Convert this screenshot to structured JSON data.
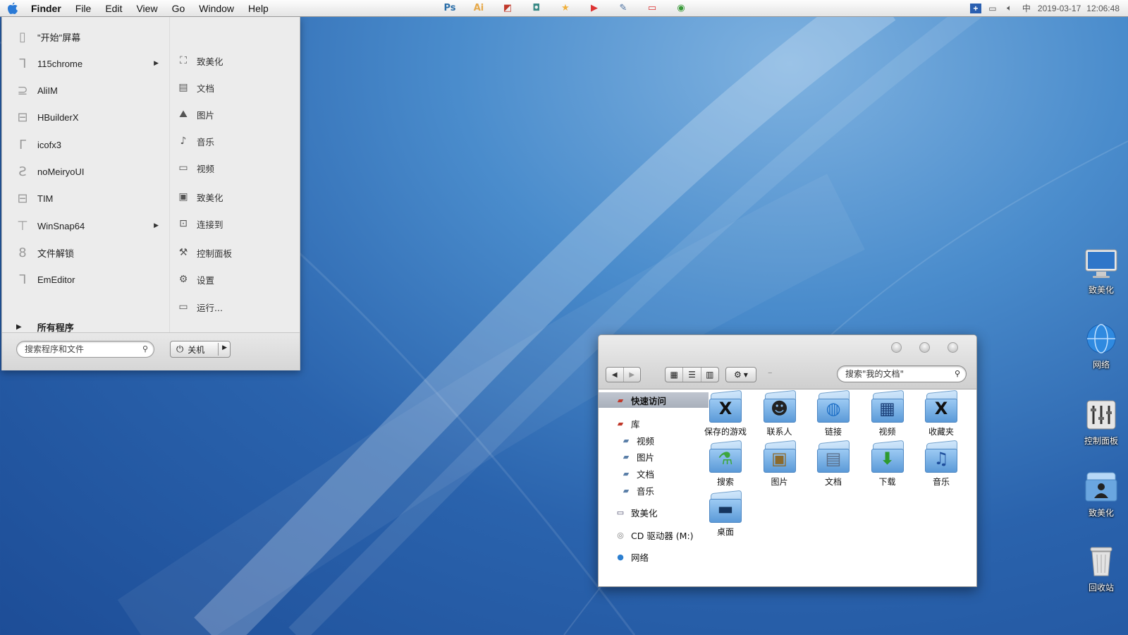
{
  "menubar": {
    "app_name": "Finder",
    "menus": [
      "File",
      "Edit",
      "View",
      "Go",
      "Window",
      "Help"
    ],
    "tray_left": [
      {
        "icon": "photoshop-icon",
        "label": "Ps",
        "color": "#2b6ea8"
      },
      {
        "icon": "illustrator-icon",
        "label": "Ai",
        "color": "#e6a94a"
      },
      {
        "icon": "screenshot-icon",
        "label": "◩",
        "color": "#c0392b"
      },
      {
        "icon": "camera-icon",
        "label": "◘",
        "color": "#3a8a86"
      },
      {
        "icon": "star-icon",
        "label": "★",
        "color": "#f0b03c"
      },
      {
        "icon": "youtube-icon",
        "label": "▶",
        "color": "#d33"
      },
      {
        "icon": "note-icon",
        "label": "✎",
        "color": "#4a6fa0"
      },
      {
        "icon": "remote-desktop-icon",
        "label": "▭",
        "color": "#d33"
      },
      {
        "icon": "chrome-icon",
        "label": "◉",
        "color": "#3a9a3a"
      }
    ],
    "tray_right": {
      "date": "2019-03-17",
      "time": "12:06:48"
    }
  },
  "start_menu": {
    "programs": [
      {
        "label": "\"开始\"屏幕",
        "icon": "start-screen-icon",
        "glyph": "▯",
        "submenu": false
      },
      {
        "label": "115chrome",
        "icon": "app-icon-115chrome",
        "glyph": "ᒣ",
        "submenu": true
      },
      {
        "label": "AliIM",
        "icon": "app-icon-aliim",
        "glyph": "⊇",
        "submenu": false
      },
      {
        "label": "HBuilderX",
        "icon": "app-icon-hbuilderx",
        "glyph": "⊟",
        "submenu": false
      },
      {
        "label": "icofx3",
        "icon": "app-icon-icofx3",
        "glyph": "ᒥ",
        "submenu": false
      },
      {
        "label": "noMeiryoUI",
        "icon": "app-icon-nomeiryoui",
        "glyph": "Ƨ",
        "submenu": false
      },
      {
        "label": "TIM",
        "icon": "app-icon-tim",
        "glyph": "⊟",
        "submenu": false
      },
      {
        "label": "WinSnap64",
        "icon": "app-icon-winsnap64",
        "glyph": "⊤",
        "submenu": true
      },
      {
        "label": "文件解锁",
        "icon": "app-icon-unlocker",
        "glyph": "8",
        "submenu": false
      },
      {
        "label": "EmEditor",
        "icon": "app-icon-emeditor",
        "glyph": "ᒣ",
        "submenu": false
      }
    ],
    "all_programs": "所有程序",
    "places": [
      {
        "label": "致美化",
        "icon": "user-icon",
        "glyph": "⛶"
      },
      {
        "label": "文档",
        "icon": "document-icon",
        "glyph": "▤"
      },
      {
        "label": "图片",
        "icon": "picture-icon",
        "glyph": "⛰"
      },
      {
        "label": "音乐",
        "icon": "music-icon",
        "glyph": "♪"
      },
      {
        "label": "视频",
        "icon": "video-icon",
        "glyph": "▭"
      },
      {
        "label": "致美化",
        "icon": "computer-icon",
        "glyph": "▣"
      },
      {
        "label": "连接到",
        "icon": "connect-icon",
        "glyph": "⊡"
      },
      {
        "label": "控制面板",
        "icon": "wrench-icon",
        "glyph": "⚒"
      },
      {
        "label": "设置",
        "icon": "settings-icon",
        "glyph": "⚙"
      },
      {
        "label": "运行...",
        "icon": "run-icon",
        "glyph": "▭"
      }
    ],
    "search_placeholder": "搜索程序和文件",
    "shutdown_label": "关机"
  },
  "finder": {
    "search_placeholder": "搜索\"我的文档\"",
    "sidebar": [
      {
        "label": "快速访问",
        "icon": "quick-access-icon",
        "glyph": "▰",
        "color": "#c0392b",
        "indent": 0,
        "selected": true
      },
      {
        "label": "库",
        "icon": "library-icon",
        "glyph": "▰",
        "color": "#c0392b",
        "indent": 0,
        "selected": false
      },
      {
        "label": "视频",
        "icon": "video-folder-icon",
        "glyph": "▰",
        "color": "#5b7fa8",
        "indent": 1,
        "selected": false
      },
      {
        "label": "图片",
        "icon": "picture-folder-icon",
        "glyph": "▰",
        "color": "#5b7fa8",
        "indent": 1,
        "selected": false
      },
      {
        "label": "文档",
        "icon": "document-folder-icon",
        "glyph": "▰",
        "color": "#5b7fa8",
        "indent": 1,
        "selected": false
      },
      {
        "label": "音乐",
        "icon": "music-folder-icon",
        "glyph": "▰",
        "color": "#5b7fa8",
        "indent": 1,
        "selected": false
      },
      {
        "label": "致美化",
        "icon": "computer-icon",
        "glyph": "▭",
        "color": "#446",
        "indent": 0,
        "selected": false
      },
      {
        "label": "CD 驱动器 (M:)",
        "icon": "cd-drive-icon",
        "glyph": "◎",
        "color": "#777",
        "indent": 0,
        "selected": false
      },
      {
        "label": "网络",
        "icon": "network-icon",
        "glyph": "●",
        "color": "#2c7fd0",
        "indent": 0,
        "selected": false
      }
    ],
    "items": [
      {
        "label": "保存的游戏",
        "icon": "saved-games-folder-icon",
        "glyph": "X",
        "color": "#111"
      },
      {
        "label": "联系人",
        "icon": "contacts-folder-icon",
        "glyph": "☻",
        "color": "#222"
      },
      {
        "label": "链接",
        "icon": "links-folder-icon",
        "glyph": "◍",
        "color": "#1e6fc6"
      },
      {
        "label": "视频",
        "icon": "videos-folder-icon",
        "glyph": "▦",
        "color": "#1a3e77"
      },
      {
        "label": "收藏夹",
        "icon": "favorites-folder-icon",
        "glyph": "X",
        "color": "#111"
      },
      {
        "label": "搜索",
        "icon": "searches-folder-icon",
        "glyph": "⚗",
        "color": "#3da63d"
      },
      {
        "label": "图片",
        "icon": "pictures-folder-icon",
        "glyph": "▣",
        "color": "#8a6a2e"
      },
      {
        "label": "文档",
        "icon": "documents-folder-icon",
        "glyph": "▤",
        "color": "#5a6f8a"
      },
      {
        "label": "下载",
        "icon": "downloads-folder-icon",
        "glyph": "⬇",
        "color": "#2e9a2e"
      },
      {
        "label": "音乐",
        "icon": "music-folder-icon",
        "glyph": "♫",
        "color": "#1e4e9c"
      },
      {
        "label": "桌面",
        "icon": "desktop-folder-icon",
        "glyph": "▬",
        "color": "#15355e"
      }
    ]
  },
  "desktop_icons": [
    {
      "label": "致美化",
      "icon": "computer-desktop-icon",
      "glyph": "▭"
    },
    {
      "label": "网络",
      "icon": "network-globe-icon",
      "glyph": "◍"
    },
    {
      "label": "控制面板",
      "icon": "control-panel-icon",
      "glyph": "⁞⁞"
    },
    {
      "label": "致美化",
      "icon": "user-folder-desktop-icon",
      "glyph": "☻"
    },
    {
      "label": "回收站",
      "icon": "trash-icon",
      "glyph": "▥"
    }
  ]
}
